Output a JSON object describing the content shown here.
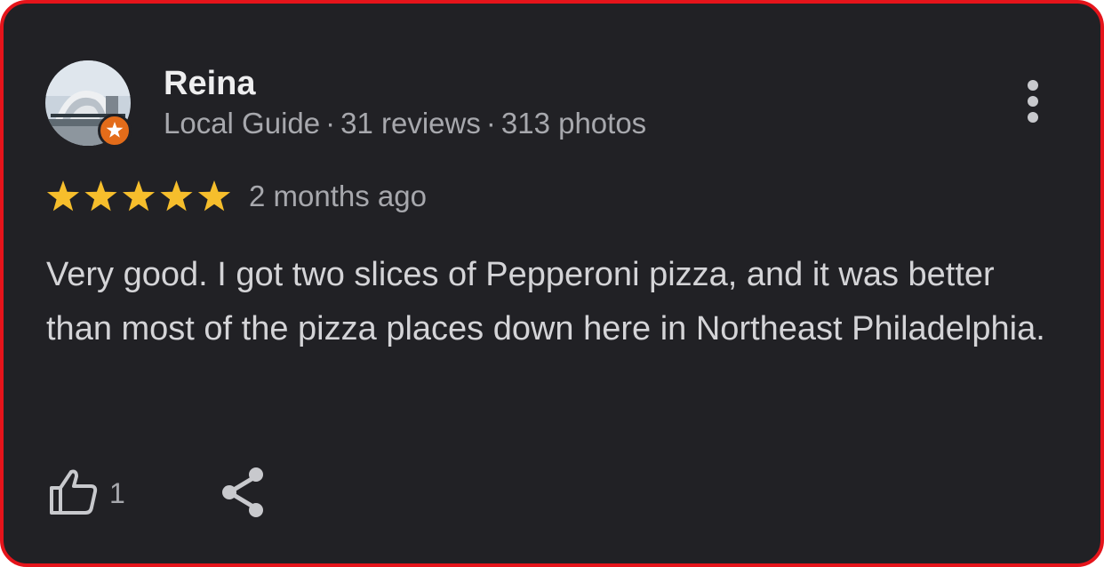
{
  "reviewer": {
    "name": "Reina",
    "guide_label": "Local Guide",
    "separator": "·",
    "reviews": "31 reviews",
    "photos": "313 photos",
    "avatar_icon": "profile-photo-avatar",
    "badge_icon": "local-guide-star-badge",
    "badge_color": "#e36c1a"
  },
  "menu": {
    "icon": "more-vertical-icon"
  },
  "review": {
    "rating": 5,
    "rating_max": 5,
    "star_color": "#f6be2c",
    "time_ago": "2 months ago",
    "text": "Very good. I got two slices of Pepperoni pizza, and it was better than most of the pizza places down here in Northeast Philadelphia."
  },
  "actions": {
    "like_icon": "thumbs-up-icon",
    "like_count": "1",
    "share_icon": "share-icon"
  },
  "colors": {
    "card_background": "#212125",
    "border": "#e5141b"
  }
}
